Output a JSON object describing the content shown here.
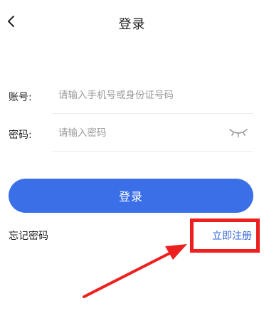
{
  "header": {
    "title": "登录",
    "back_icon": "chevron-left-icon"
  },
  "form": {
    "account": {
      "label": "账号:",
      "placeholder": "请输入手机号或身份证号码",
      "value": ""
    },
    "password": {
      "label": "密码:",
      "placeholder": "请输入密码",
      "value": "",
      "toggle_icon": "eye-closed-icon"
    }
  },
  "actions": {
    "login_label": "登录",
    "forgot_label": "忘记密码",
    "register_label": "立即注册"
  },
  "colors": {
    "primary": "#3a6fe8",
    "link": "#2f63d8",
    "annotation": "#ee1f1f"
  }
}
